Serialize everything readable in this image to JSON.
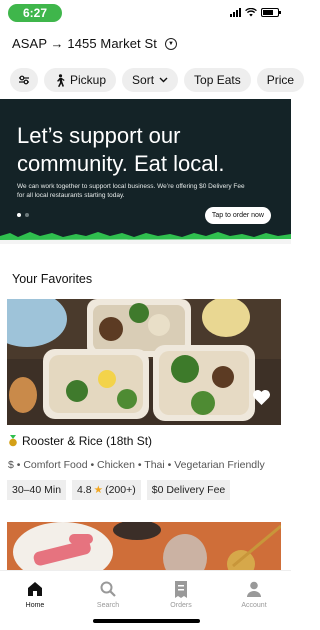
{
  "status_bar": {
    "time": "6:27",
    "battery_level": 0.7
  },
  "address": {
    "label": "ASAP → 1455 Market St"
  },
  "filters": [
    {
      "icon": "sliders-icon",
      "label": ""
    },
    {
      "icon": "walking-person-icon",
      "label": "Pickup"
    },
    {
      "icon": "chevron-down-icon",
      "label": "Sort"
    },
    {
      "icon": "",
      "label": "Top Eats"
    },
    {
      "icon": "",
      "label": "Price"
    }
  ],
  "hero": {
    "title": "Let’s support our community. Eat local.",
    "body": "We can work together to support local business. We’re offering $0 Delivery Fee for all local restaurants starting today.",
    "cta": "Tap to order now",
    "colors": {
      "background": "#142327",
      "grass": "#2fbf4e"
    }
  },
  "favorites": {
    "section_title": "Your Favorites",
    "restaurant": {
      "name": "Rooster & Rice (18th St)",
      "badge_icon": "medal-icon",
      "tags": "$ • Comfort Food • Chicken • Thai • Vegetarian Friendly",
      "eta": "30–40 Min",
      "rating": "4.8",
      "rating_count": "(200+)",
      "delivery_fee": "$0 Delivery Fee"
    }
  },
  "tabbar": [
    {
      "icon": "home-icon",
      "label": "Home",
      "active": true
    },
    {
      "icon": "search-icon",
      "label": "Search",
      "active": false
    },
    {
      "icon": "receipt-icon",
      "label": "Orders",
      "active": false
    },
    {
      "icon": "person-icon",
      "label": "Account",
      "active": false
    }
  ]
}
